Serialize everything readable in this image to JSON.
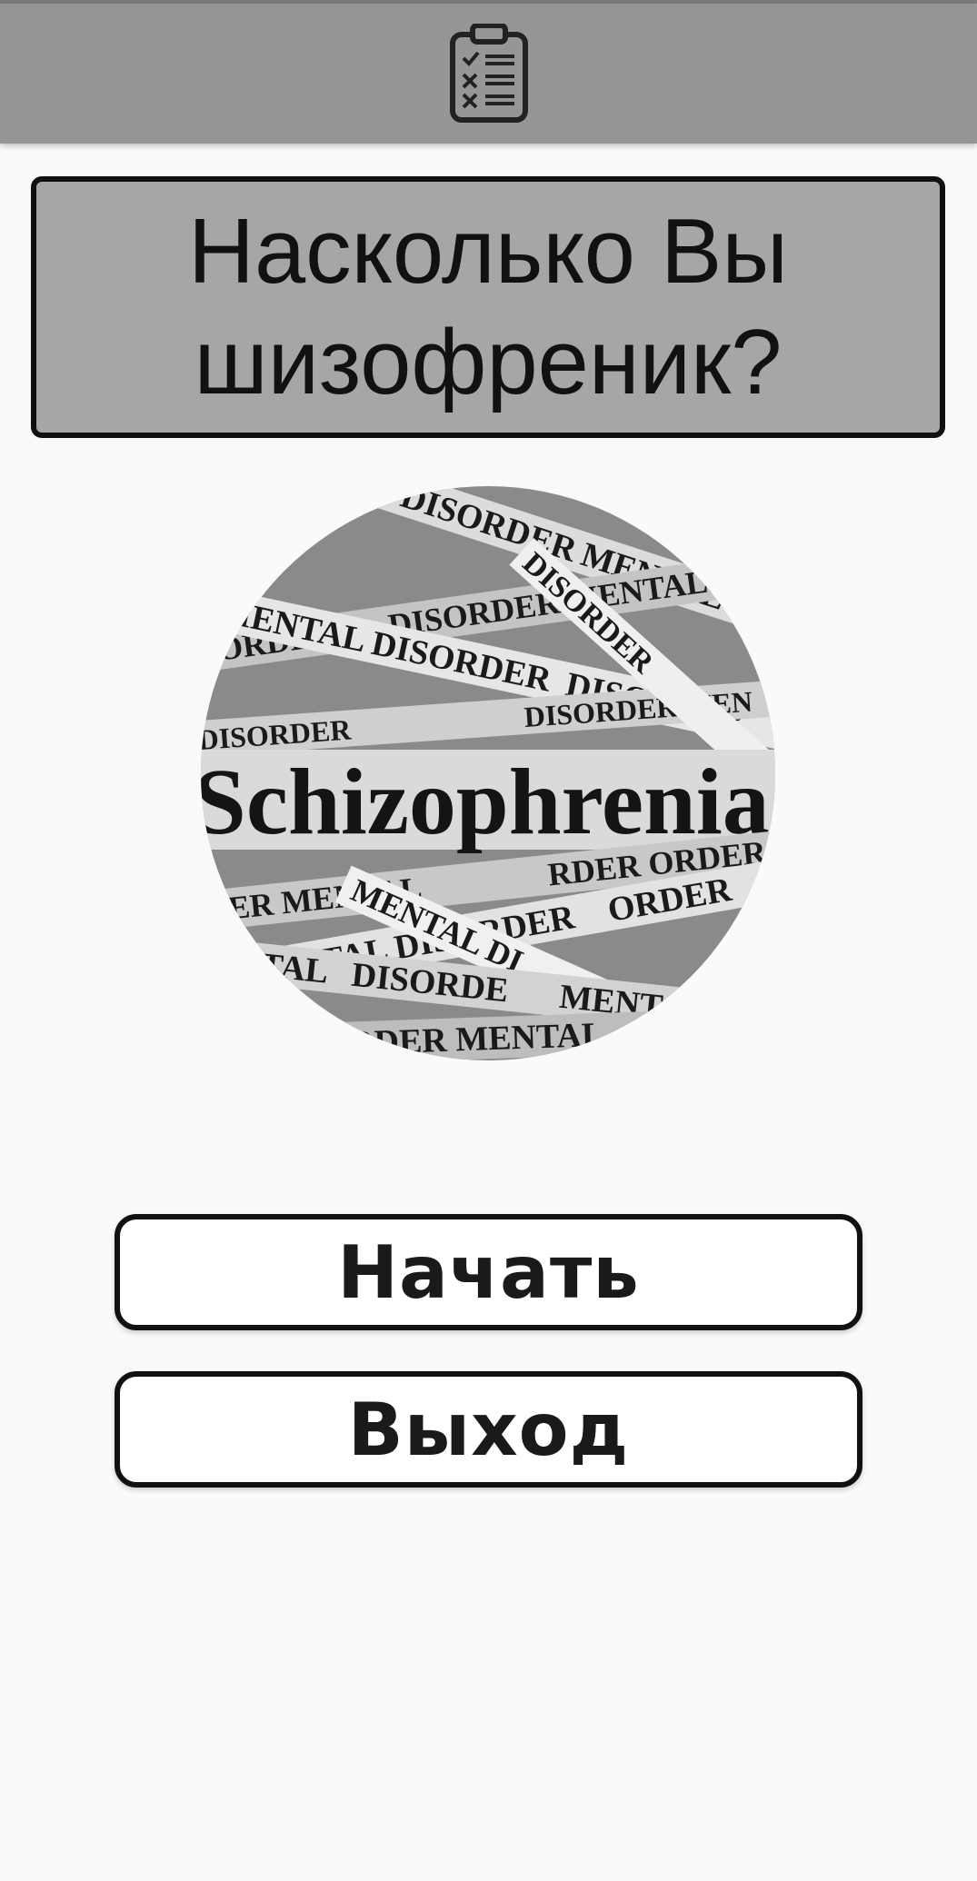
{
  "toolbar": {
    "icon": "clipboard-checklist-icon",
    "background_color": "#969696"
  },
  "title": {
    "text": "Насколько Вы шизофреник?",
    "background_color": "#a6a6a6"
  },
  "hero_image": {
    "icon": "schizophrenia-newspaper-collage-image",
    "headline": "Schizophrenia",
    "strip_texts": [
      "MENTAL DISORDER",
      "DISORDER",
      "MENTAL",
      "DISORDER MENTAL",
      "MENTAL DISORDER"
    ]
  },
  "buttons": {
    "start_label": "Начать",
    "exit_label": "Выход"
  }
}
